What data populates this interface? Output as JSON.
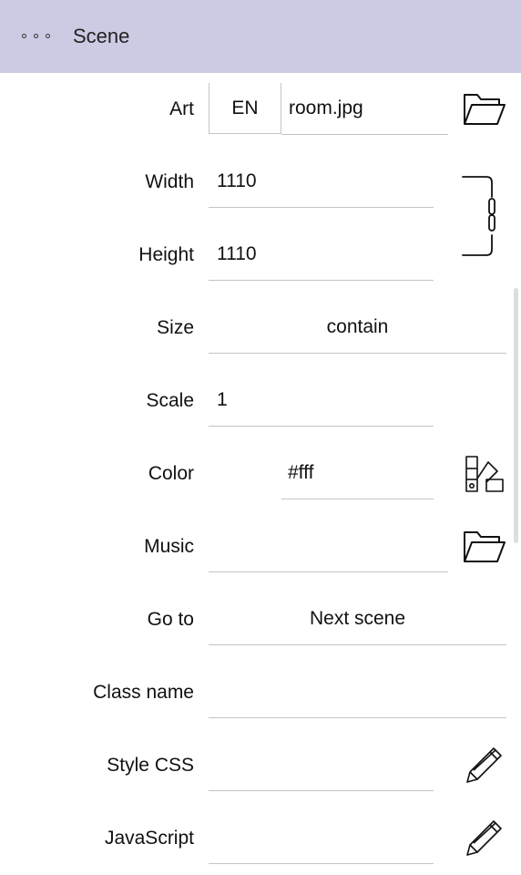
{
  "header": {
    "title": "Scene",
    "menu_icon": "more-dots-icon",
    "background": "#cdcae4"
  },
  "rows": {
    "art": {
      "label": "Art",
      "language": "EN",
      "value": "room.jpg",
      "icon": "folder-open-icon"
    },
    "width": {
      "label": "Width",
      "value": "1110"
    },
    "height": {
      "label": "Height",
      "value": "1110",
      "link_icon": "link-chain-icon"
    },
    "size": {
      "label": "Size",
      "value": "contain"
    },
    "scale": {
      "label": "Scale",
      "value": "1"
    },
    "color": {
      "label": "Color",
      "value": "#fff",
      "icon": "color-palette-icon"
    },
    "music": {
      "label": "Music",
      "value": "",
      "icon": "folder-open-icon"
    },
    "goto": {
      "label": "Go to",
      "value": "Next scene"
    },
    "classname": {
      "label": "Class name",
      "value": ""
    },
    "stylecss": {
      "label": "Style CSS",
      "value": "",
      "icon": "pencil-icon"
    },
    "javascript": {
      "label": "JavaScript",
      "value": "",
      "icon": "pencil-icon"
    }
  }
}
